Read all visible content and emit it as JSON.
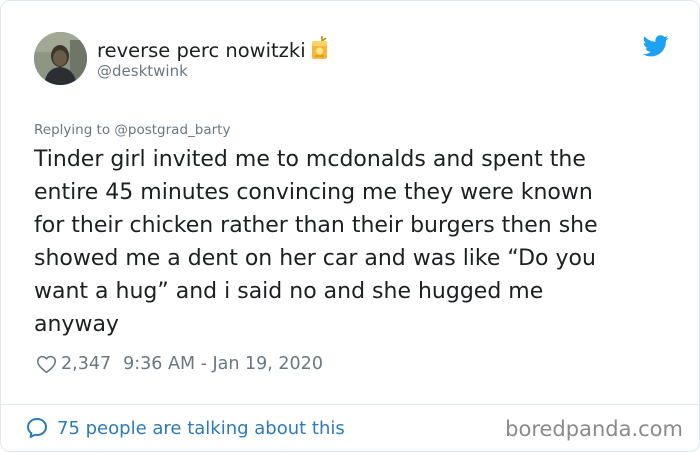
{
  "user": {
    "display_name": "reverse perc nowitzki",
    "handle": "@desktwink",
    "badge_icon": "juice-box-icon"
  },
  "reply": {
    "text": "Replying to @postgrad_barty"
  },
  "tweet": {
    "text": "Tinder girl invited me to mcdonalds and spent the\nentire 45 minutes convincing me they were known\nfor their chicken rather than their burgers then she\nshowed me a dent on her car and was like “Do you\nwant a hug” and i said no and she hugged me\nanyway",
    "likes": "2,347",
    "timestamp": "9:36 AM - Jan 19, 2020"
  },
  "footer": {
    "conversation": "75 people are talking about this",
    "watermark": "boredpanda.com"
  },
  "colors": {
    "twitter_blue": "#1da1f2",
    "link_blue": "#2b7bb9",
    "text": "#1c2022",
    "muted": "#697882"
  }
}
